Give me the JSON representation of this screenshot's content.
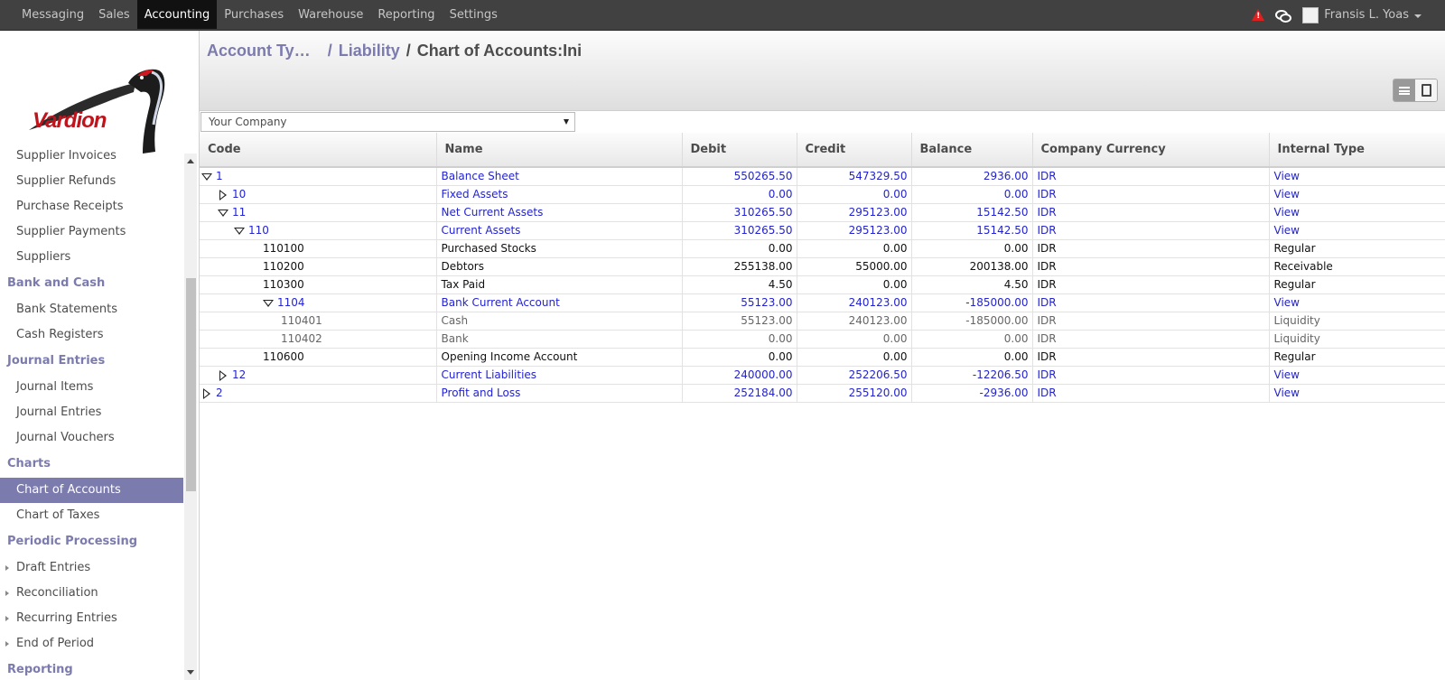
{
  "topbar": {
    "menu": [
      "Messaging",
      "Sales",
      "Accounting",
      "Purchases",
      "Warehouse",
      "Reporting",
      "Settings"
    ],
    "active": "Accounting",
    "user_name": "Fransis L. Yoas"
  },
  "logo": {
    "text": "Vardion"
  },
  "sidebar": {
    "items": [
      {
        "type": "item",
        "label": "Supplier Invoices"
      },
      {
        "type": "item",
        "label": "Supplier Refunds"
      },
      {
        "type": "item",
        "label": "Purchase Receipts"
      },
      {
        "type": "item",
        "label": "Supplier Payments"
      },
      {
        "type": "item",
        "label": "Suppliers"
      },
      {
        "type": "section",
        "label": "Bank and Cash"
      },
      {
        "type": "item",
        "label": "Bank Statements"
      },
      {
        "type": "item",
        "label": "Cash Registers"
      },
      {
        "type": "section",
        "label": "Journal Entries"
      },
      {
        "type": "item",
        "label": "Journal Items"
      },
      {
        "type": "item",
        "label": "Journal Entries"
      },
      {
        "type": "item",
        "label": "Journal Vouchers"
      },
      {
        "type": "section",
        "label": "Charts"
      },
      {
        "type": "item",
        "label": "Chart of Accounts",
        "active": true
      },
      {
        "type": "item",
        "label": "Chart of Taxes"
      },
      {
        "type": "section",
        "label": "Periodic Processing"
      },
      {
        "type": "item",
        "label": "Draft Entries",
        "expandable": true
      },
      {
        "type": "item",
        "label": "Reconciliation",
        "expandable": true
      },
      {
        "type": "item",
        "label": "Recurring Entries",
        "expandable": true
      },
      {
        "type": "item",
        "label": "End of Period",
        "expandable": true
      },
      {
        "type": "section",
        "label": "Reporting"
      }
    ]
  },
  "breadcrumb": {
    "level1": "Account Ty…",
    "level2": "Liability",
    "current": "Chart of Accounts:Ini",
    "sep": "/"
  },
  "company": {
    "selected": "Your Company"
  },
  "table": {
    "columns": [
      "Code",
      "Name",
      "Debit",
      "Credit",
      "Balance",
      "Company Currency",
      "Internal Type"
    ],
    "rows": [
      {
        "code": "1",
        "name": "Balance Sheet",
        "debit": "550265.50",
        "credit": "547329.50",
        "balance": "2936.00",
        "currency": "IDR",
        "type": "View",
        "level": 0,
        "toggle": "open",
        "style": "view"
      },
      {
        "code": "10",
        "name": "Fixed Assets",
        "debit": "0.00",
        "credit": "0.00",
        "balance": "0.00",
        "currency": "IDR",
        "type": "View",
        "level": 1,
        "toggle": "closed",
        "style": "view"
      },
      {
        "code": "11",
        "name": "Net Current Assets",
        "debit": "310265.50",
        "credit": "295123.00",
        "balance": "15142.50",
        "currency": "IDR",
        "type": "View",
        "level": 1,
        "toggle": "open",
        "style": "view"
      },
      {
        "code": "110",
        "name": "Current Assets",
        "debit": "310265.50",
        "credit": "295123.00",
        "balance": "15142.50",
        "currency": "IDR",
        "type": "View",
        "level": 2,
        "toggle": "open",
        "style": "view"
      },
      {
        "code": "110100",
        "name": "Purchased Stocks",
        "debit": "0.00",
        "credit": "0.00",
        "balance": "0.00",
        "currency": "IDR",
        "type": "Regular",
        "level": 3,
        "toggle": "",
        "style": "leaf"
      },
      {
        "code": "110200",
        "name": "Debtors",
        "debit": "255138.00",
        "credit": "55000.00",
        "balance": "200138.00",
        "currency": "IDR",
        "type": "Receivable",
        "level": 3,
        "toggle": "",
        "style": "leaf"
      },
      {
        "code": "110300",
        "name": "Tax Paid",
        "debit": "4.50",
        "credit": "0.00",
        "balance": "4.50",
        "currency": "IDR",
        "type": "Regular",
        "level": 3,
        "toggle": "",
        "style": "leaf"
      },
      {
        "code": "1104",
        "name": "Bank Current Account",
        "debit": "55123.00",
        "credit": "240123.00",
        "balance": "-185000.00",
        "currency": "IDR",
        "type": "View",
        "level": 3,
        "toggle": "open",
        "style": "view"
      },
      {
        "code": "110401",
        "name": "Cash",
        "debit": "55123.00",
        "credit": "240123.00",
        "balance": "-185000.00",
        "currency": "IDR",
        "type": "Liquidity",
        "level": 4,
        "toggle": "",
        "style": "deep"
      },
      {
        "code": "110402",
        "name": "Bank",
        "debit": "0.00",
        "credit": "0.00",
        "balance": "0.00",
        "currency": "IDR",
        "type": "Liquidity",
        "level": 4,
        "toggle": "",
        "style": "deep"
      },
      {
        "code": "110600",
        "name": "Opening Income Account",
        "debit": "0.00",
        "credit": "0.00",
        "balance": "0.00",
        "currency": "IDR",
        "type": "Regular",
        "level": 3,
        "toggle": "",
        "style": "leaf"
      },
      {
        "code": "12",
        "name": "Current Liabilities",
        "debit": "240000.00",
        "credit": "252206.50",
        "balance": "-12206.50",
        "currency": "IDR",
        "type": "View",
        "level": 1,
        "toggle": "closed",
        "style": "view"
      },
      {
        "code": "2",
        "name": "Profit and Loss",
        "debit": "252184.00",
        "credit": "255120.00",
        "balance": "-2936.00",
        "currency": "IDR",
        "type": "View",
        "level": 0,
        "toggle": "closed",
        "style": "view"
      }
    ]
  }
}
